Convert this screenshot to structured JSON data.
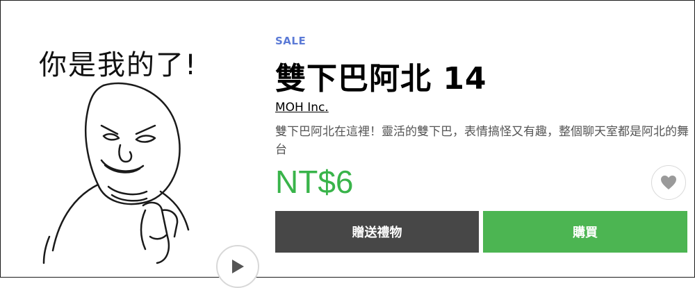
{
  "sticker": {
    "caption": "你是我的了!"
  },
  "product": {
    "sale_label": "SALE",
    "title": "雙下巴阿北 14",
    "author": "MOH Inc.",
    "description": "雙下巴阿北在這裡！靈活的雙下巴，表情搞怪又有趣，整個聊天室都是阿北的舞台",
    "price": "NT$6"
  },
  "buttons": {
    "gift_label": "贈送禮物",
    "buy_label": "購買"
  },
  "icons": {
    "play": "play-icon",
    "heart": "heart-icon"
  },
  "colors": {
    "sale": "#5b7ad6",
    "price": "#39b44a",
    "gift_button": "#474747",
    "buy_button": "#4cb552"
  }
}
